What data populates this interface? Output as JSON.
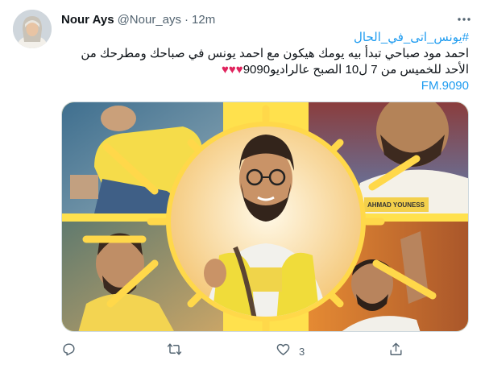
{
  "tweet": {
    "display_name": "Nour Ays",
    "handle": "@Nour_ays",
    "separator": "·",
    "time": "12m",
    "hashtag": "#يونس_اتى_في_الحال",
    "text": "احمد مود صباحي تبدأ بيه يومك هيكون مع احمد يونس في صباحك ومطرحك من الأحد للخميس من 7 ل10 الصبح عالراديو9090",
    "hearts": "♥♥♥",
    "link": "9090.FM",
    "like_count": "3"
  },
  "media": {
    "caption_badge": "AHMAD YOUNESS"
  },
  "colors": {
    "accent": "#1d9bf0",
    "heart": "#e0245e",
    "frame_yellow": "#ffd84a",
    "muted": "#536471"
  },
  "icons": {
    "reply": "reply-icon",
    "retweet": "retweet-icon",
    "like": "like-icon",
    "share": "share-icon",
    "more": "more-icon"
  }
}
